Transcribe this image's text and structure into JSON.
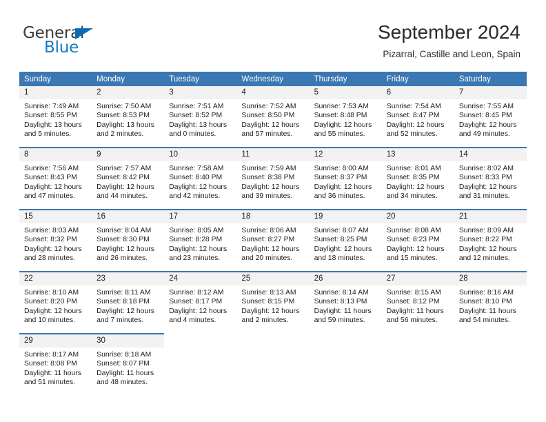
{
  "brand": {
    "name_top": "General",
    "name_bottom": "Blue",
    "triangle_color": "#0a6cb5",
    "text_color": "#3c3c3c",
    "blue_color": "#1279c6"
  },
  "header": {
    "title": "September 2024",
    "subtitle": "Pizarral, Castille and Leon, Spain"
  },
  "theme": {
    "header_blue": "#3b77b2",
    "daynum_band": "#f2f2f2",
    "text": "#1d1d1d"
  },
  "weekday_headers": [
    "Sunday",
    "Monday",
    "Tuesday",
    "Wednesday",
    "Thursday",
    "Friday",
    "Saturday"
  ],
  "labels": {
    "sunrise": "Sunrise:",
    "sunset": "Sunset:",
    "daylight": "Daylight:"
  },
  "weeks": [
    [
      {
        "day": "1",
        "sunrise": "Sunrise: 7:49 AM",
        "sunset": "Sunset: 8:55 PM",
        "daylight_line1": "Daylight: 13 hours",
        "daylight_line2": "and 5 minutes."
      },
      {
        "day": "2",
        "sunrise": "Sunrise: 7:50 AM",
        "sunset": "Sunset: 8:53 PM",
        "daylight_line1": "Daylight: 13 hours",
        "daylight_line2": "and 2 minutes."
      },
      {
        "day": "3",
        "sunrise": "Sunrise: 7:51 AM",
        "sunset": "Sunset: 8:52 PM",
        "daylight_line1": "Daylight: 13 hours",
        "daylight_line2": "and 0 minutes."
      },
      {
        "day": "4",
        "sunrise": "Sunrise: 7:52 AM",
        "sunset": "Sunset: 8:50 PM",
        "daylight_line1": "Daylight: 12 hours",
        "daylight_line2": "and 57 minutes."
      },
      {
        "day": "5",
        "sunrise": "Sunrise: 7:53 AM",
        "sunset": "Sunset: 8:48 PM",
        "daylight_line1": "Daylight: 12 hours",
        "daylight_line2": "and 55 minutes."
      },
      {
        "day": "6",
        "sunrise": "Sunrise: 7:54 AM",
        "sunset": "Sunset: 8:47 PM",
        "daylight_line1": "Daylight: 12 hours",
        "daylight_line2": "and 52 minutes."
      },
      {
        "day": "7",
        "sunrise": "Sunrise: 7:55 AM",
        "sunset": "Sunset: 8:45 PM",
        "daylight_line1": "Daylight: 12 hours",
        "daylight_line2": "and 49 minutes."
      }
    ],
    [
      {
        "day": "8",
        "sunrise": "Sunrise: 7:56 AM",
        "sunset": "Sunset: 8:43 PM",
        "daylight_line1": "Daylight: 12 hours",
        "daylight_line2": "and 47 minutes."
      },
      {
        "day": "9",
        "sunrise": "Sunrise: 7:57 AM",
        "sunset": "Sunset: 8:42 PM",
        "daylight_line1": "Daylight: 12 hours",
        "daylight_line2": "and 44 minutes."
      },
      {
        "day": "10",
        "sunrise": "Sunrise: 7:58 AM",
        "sunset": "Sunset: 8:40 PM",
        "daylight_line1": "Daylight: 12 hours",
        "daylight_line2": "and 42 minutes."
      },
      {
        "day": "11",
        "sunrise": "Sunrise: 7:59 AM",
        "sunset": "Sunset: 8:38 PM",
        "daylight_line1": "Daylight: 12 hours",
        "daylight_line2": "and 39 minutes."
      },
      {
        "day": "12",
        "sunrise": "Sunrise: 8:00 AM",
        "sunset": "Sunset: 8:37 PM",
        "daylight_line1": "Daylight: 12 hours",
        "daylight_line2": "and 36 minutes."
      },
      {
        "day": "13",
        "sunrise": "Sunrise: 8:01 AM",
        "sunset": "Sunset: 8:35 PM",
        "daylight_line1": "Daylight: 12 hours",
        "daylight_line2": "and 34 minutes."
      },
      {
        "day": "14",
        "sunrise": "Sunrise: 8:02 AM",
        "sunset": "Sunset: 8:33 PM",
        "daylight_line1": "Daylight: 12 hours",
        "daylight_line2": "and 31 minutes."
      }
    ],
    [
      {
        "day": "15",
        "sunrise": "Sunrise: 8:03 AM",
        "sunset": "Sunset: 8:32 PM",
        "daylight_line1": "Daylight: 12 hours",
        "daylight_line2": "and 28 minutes."
      },
      {
        "day": "16",
        "sunrise": "Sunrise: 8:04 AM",
        "sunset": "Sunset: 8:30 PM",
        "daylight_line1": "Daylight: 12 hours",
        "daylight_line2": "and 26 minutes."
      },
      {
        "day": "17",
        "sunrise": "Sunrise: 8:05 AM",
        "sunset": "Sunset: 8:28 PM",
        "daylight_line1": "Daylight: 12 hours",
        "daylight_line2": "and 23 minutes."
      },
      {
        "day": "18",
        "sunrise": "Sunrise: 8:06 AM",
        "sunset": "Sunset: 8:27 PM",
        "daylight_line1": "Daylight: 12 hours",
        "daylight_line2": "and 20 minutes."
      },
      {
        "day": "19",
        "sunrise": "Sunrise: 8:07 AM",
        "sunset": "Sunset: 8:25 PM",
        "daylight_line1": "Daylight: 12 hours",
        "daylight_line2": "and 18 minutes."
      },
      {
        "day": "20",
        "sunrise": "Sunrise: 8:08 AM",
        "sunset": "Sunset: 8:23 PM",
        "daylight_line1": "Daylight: 12 hours",
        "daylight_line2": "and 15 minutes."
      },
      {
        "day": "21",
        "sunrise": "Sunrise: 8:09 AM",
        "sunset": "Sunset: 8:22 PM",
        "daylight_line1": "Daylight: 12 hours",
        "daylight_line2": "and 12 minutes."
      }
    ],
    [
      {
        "day": "22",
        "sunrise": "Sunrise: 8:10 AM",
        "sunset": "Sunset: 8:20 PM",
        "daylight_line1": "Daylight: 12 hours",
        "daylight_line2": "and 10 minutes."
      },
      {
        "day": "23",
        "sunrise": "Sunrise: 8:11 AM",
        "sunset": "Sunset: 8:18 PM",
        "daylight_line1": "Daylight: 12 hours",
        "daylight_line2": "and 7 minutes."
      },
      {
        "day": "24",
        "sunrise": "Sunrise: 8:12 AM",
        "sunset": "Sunset: 8:17 PM",
        "daylight_line1": "Daylight: 12 hours",
        "daylight_line2": "and 4 minutes."
      },
      {
        "day": "25",
        "sunrise": "Sunrise: 8:13 AM",
        "sunset": "Sunset: 8:15 PM",
        "daylight_line1": "Daylight: 12 hours",
        "daylight_line2": "and 2 minutes."
      },
      {
        "day": "26",
        "sunrise": "Sunrise: 8:14 AM",
        "sunset": "Sunset: 8:13 PM",
        "daylight_line1": "Daylight: 11 hours",
        "daylight_line2": "and 59 minutes."
      },
      {
        "day": "27",
        "sunrise": "Sunrise: 8:15 AM",
        "sunset": "Sunset: 8:12 PM",
        "daylight_line1": "Daylight: 11 hours",
        "daylight_line2": "and 56 minutes."
      },
      {
        "day": "28",
        "sunrise": "Sunrise: 8:16 AM",
        "sunset": "Sunset: 8:10 PM",
        "daylight_line1": "Daylight: 11 hours",
        "daylight_line2": "and 54 minutes."
      }
    ],
    [
      {
        "day": "29",
        "sunrise": "Sunrise: 8:17 AM",
        "sunset": "Sunset: 8:08 PM",
        "daylight_line1": "Daylight: 11 hours",
        "daylight_line2": "and 51 minutes."
      },
      {
        "day": "30",
        "sunrise": "Sunrise: 8:18 AM",
        "sunset": "Sunset: 8:07 PM",
        "daylight_line1": "Daylight: 11 hours",
        "daylight_line2": "and 48 minutes."
      },
      {
        "day": "",
        "sunrise": "",
        "sunset": "",
        "daylight_line1": "",
        "daylight_line2": ""
      },
      {
        "day": "",
        "sunrise": "",
        "sunset": "",
        "daylight_line1": "",
        "daylight_line2": ""
      },
      {
        "day": "",
        "sunrise": "",
        "sunset": "",
        "daylight_line1": "",
        "daylight_line2": ""
      },
      {
        "day": "",
        "sunrise": "",
        "sunset": "",
        "daylight_line1": "",
        "daylight_line2": ""
      },
      {
        "day": "",
        "sunrise": "",
        "sunset": "",
        "daylight_line1": "",
        "daylight_line2": ""
      }
    ]
  ]
}
